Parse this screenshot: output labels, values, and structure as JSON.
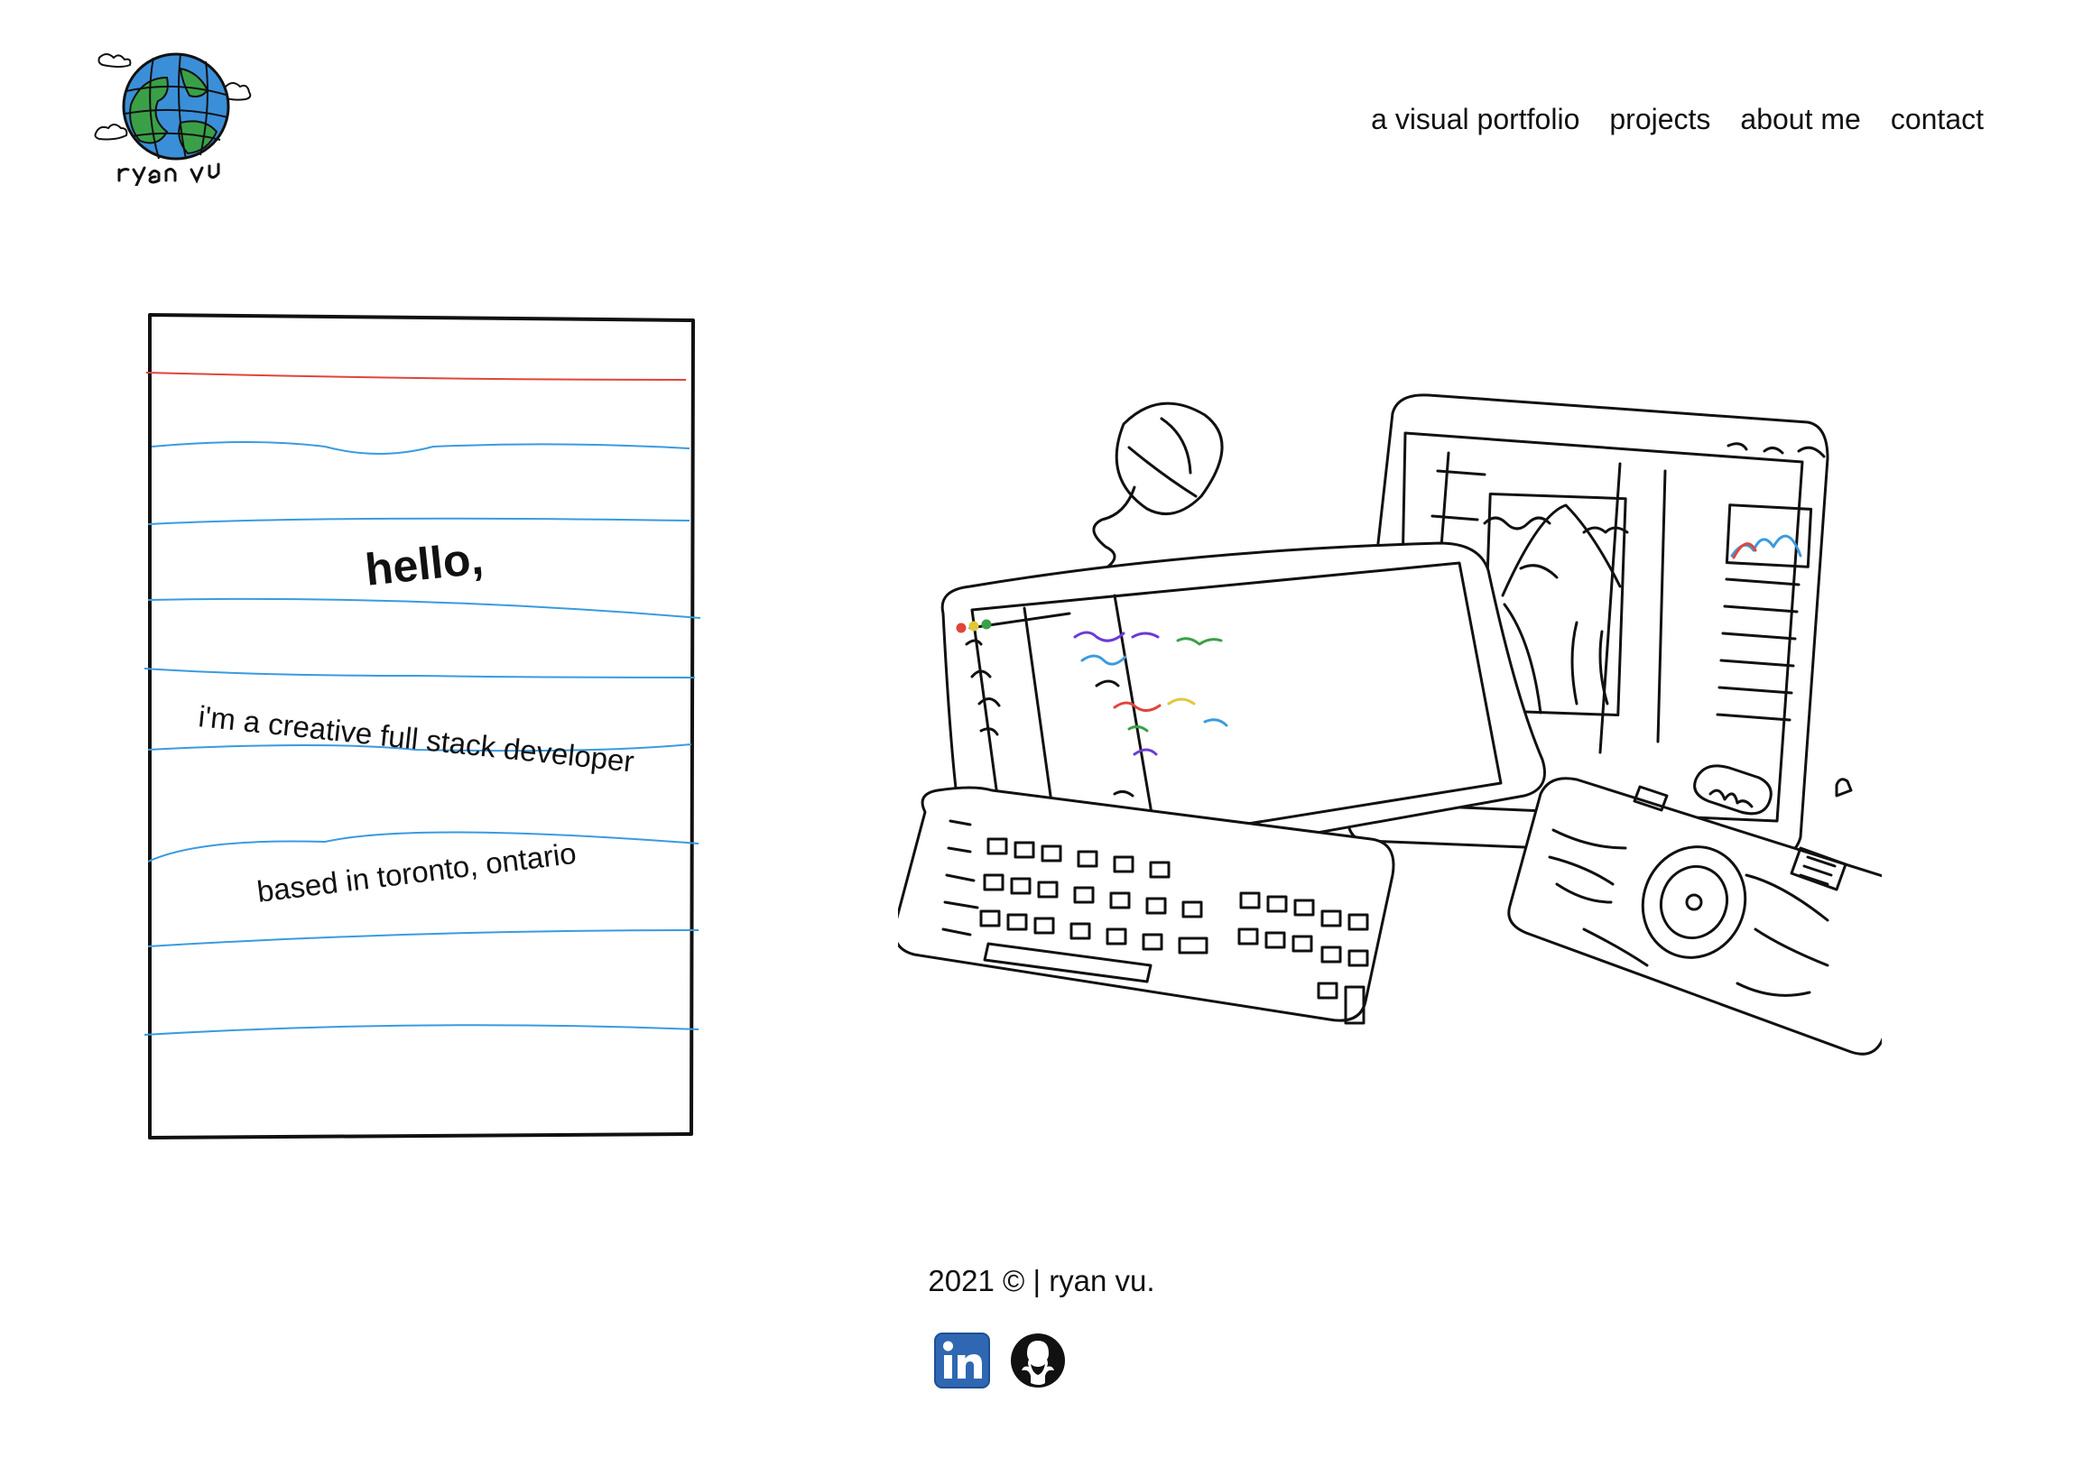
{
  "header": {
    "logo_alt": "ryan vu",
    "nav": [
      {
        "label": "a visual portfolio"
      },
      {
        "label": "projects"
      },
      {
        "label": "about me"
      },
      {
        "label": "contact"
      }
    ]
  },
  "hero": {
    "greeting": "hello,",
    "tagline": "i'm a creative full stack developer",
    "location": "based in toronto, ontario"
  },
  "footer": {
    "copyright": "2021 © | ryan vu.",
    "social": [
      {
        "icon": "linkedin-icon",
        "color": "#2f67b2"
      },
      {
        "icon": "github-icon",
        "color": "#111111"
      }
    ]
  },
  "colors": {
    "notebook_margin_line": "#e0453b",
    "notebook_rule_line": "#3a9be0",
    "globe_ocean": "#3a8fd8",
    "globe_land": "#3aa048"
  }
}
